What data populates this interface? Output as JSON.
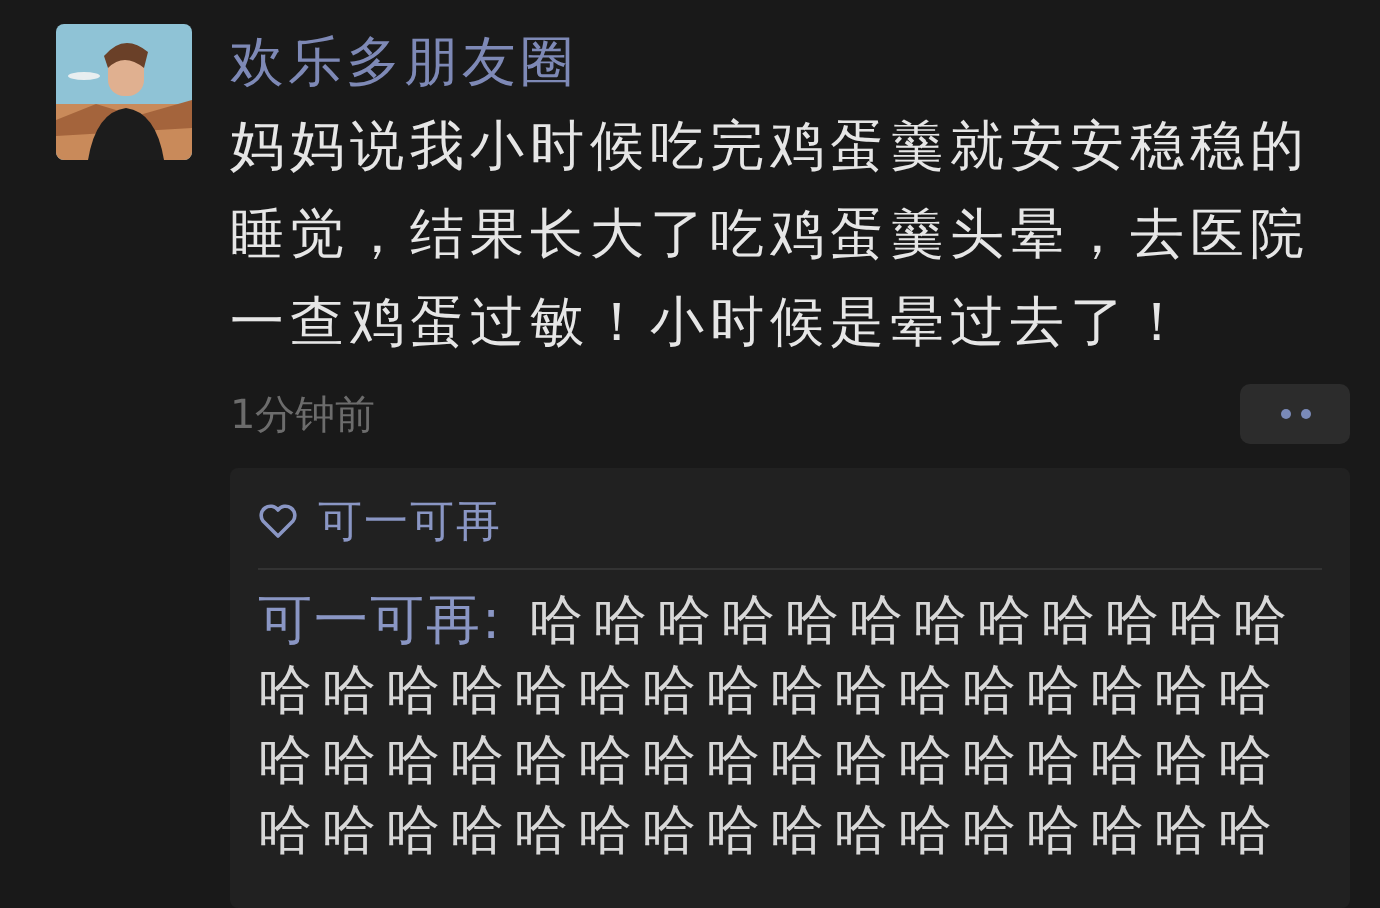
{
  "post": {
    "author": "欢乐多朋友圈",
    "text": "妈妈说我小时候吃完鸡蛋羹就安安稳稳的睡觉，结果长大了吃鸡蛋羹头晕，去医院一查鸡蛋过敏！小时候是晕过去了！",
    "time": "1分钟前"
  },
  "likes": [
    {
      "name": "可一可再"
    }
  ],
  "comments": [
    {
      "author": "可一可再:",
      "text": "哈哈哈哈哈哈哈哈哈哈哈哈哈哈哈哈哈哈哈哈哈哈哈哈哈哈哈哈哈哈哈哈哈哈哈哈哈哈哈哈哈哈哈哈哈哈哈哈哈哈哈哈哈哈哈哈哈哈哈哈"
    }
  ]
}
